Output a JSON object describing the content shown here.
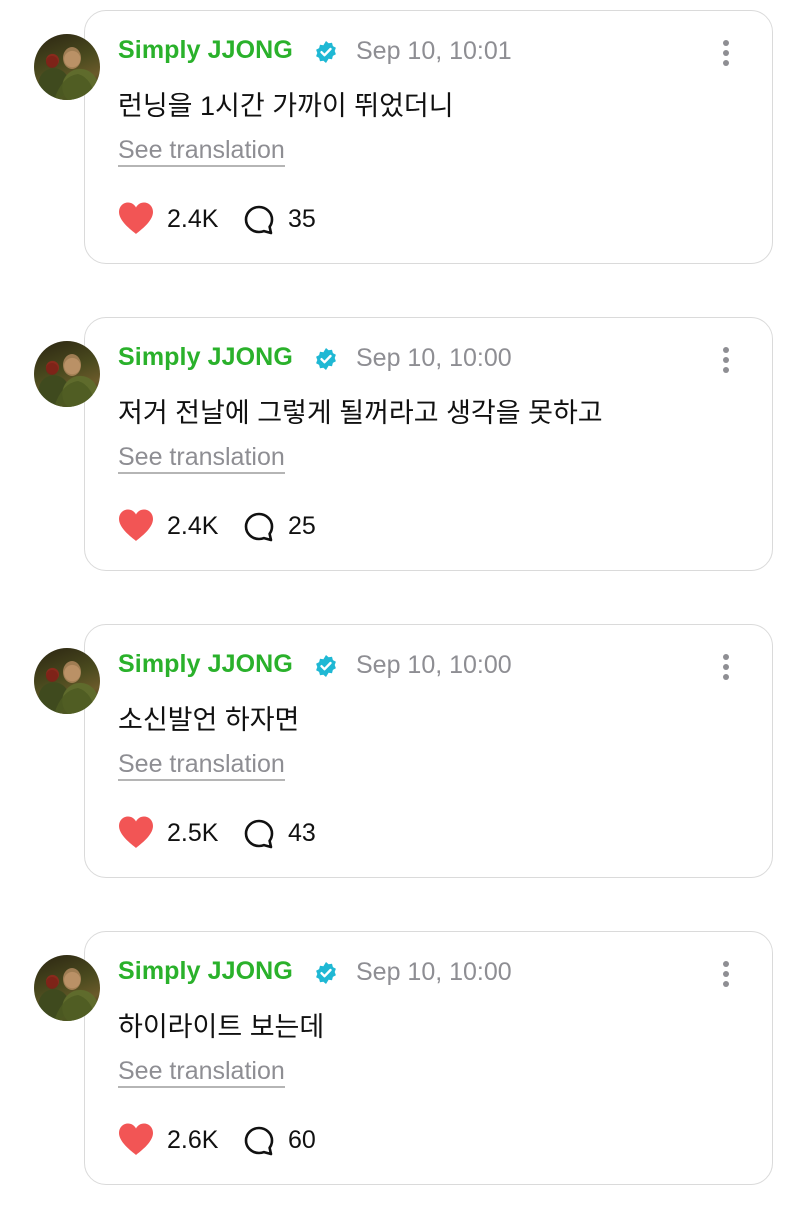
{
  "posts": [
    {
      "author": "Simply JJONG",
      "timestamp": "Sep 10, 10:01",
      "text": "런닝을 1시간 가까이 뛰었더니",
      "translate_label": "See translation",
      "likes": "2.4K",
      "comments": "35"
    },
    {
      "author": "Simply JJONG",
      "timestamp": "Sep 10, 10:00",
      "text": "저거 전날에 그렇게 될꺼라고 생각을 못하고",
      "translate_label": "See translation",
      "likes": "2.4K",
      "comments": "25"
    },
    {
      "author": "Simply JJONG",
      "timestamp": "Sep 10, 10:00",
      "text": "소신발언 하자면",
      "translate_label": "See translation",
      "likes": "2.5K",
      "comments": "43"
    },
    {
      "author": "Simply JJONG",
      "timestamp": "Sep 10, 10:00",
      "text": "하이라이트 보는데",
      "translate_label": "See translation",
      "likes": "2.6K",
      "comments": "60"
    }
  ],
  "colors": {
    "author_green": "#2ab12b",
    "verified_badge": "#1fb8d4",
    "heart_red": "#f25555",
    "muted_gray": "#8e8e93"
  },
  "icons": {
    "verified": "verified-badge-icon",
    "more": "more-options-icon",
    "like": "heart-icon",
    "comment": "comment-bubble-icon"
  }
}
